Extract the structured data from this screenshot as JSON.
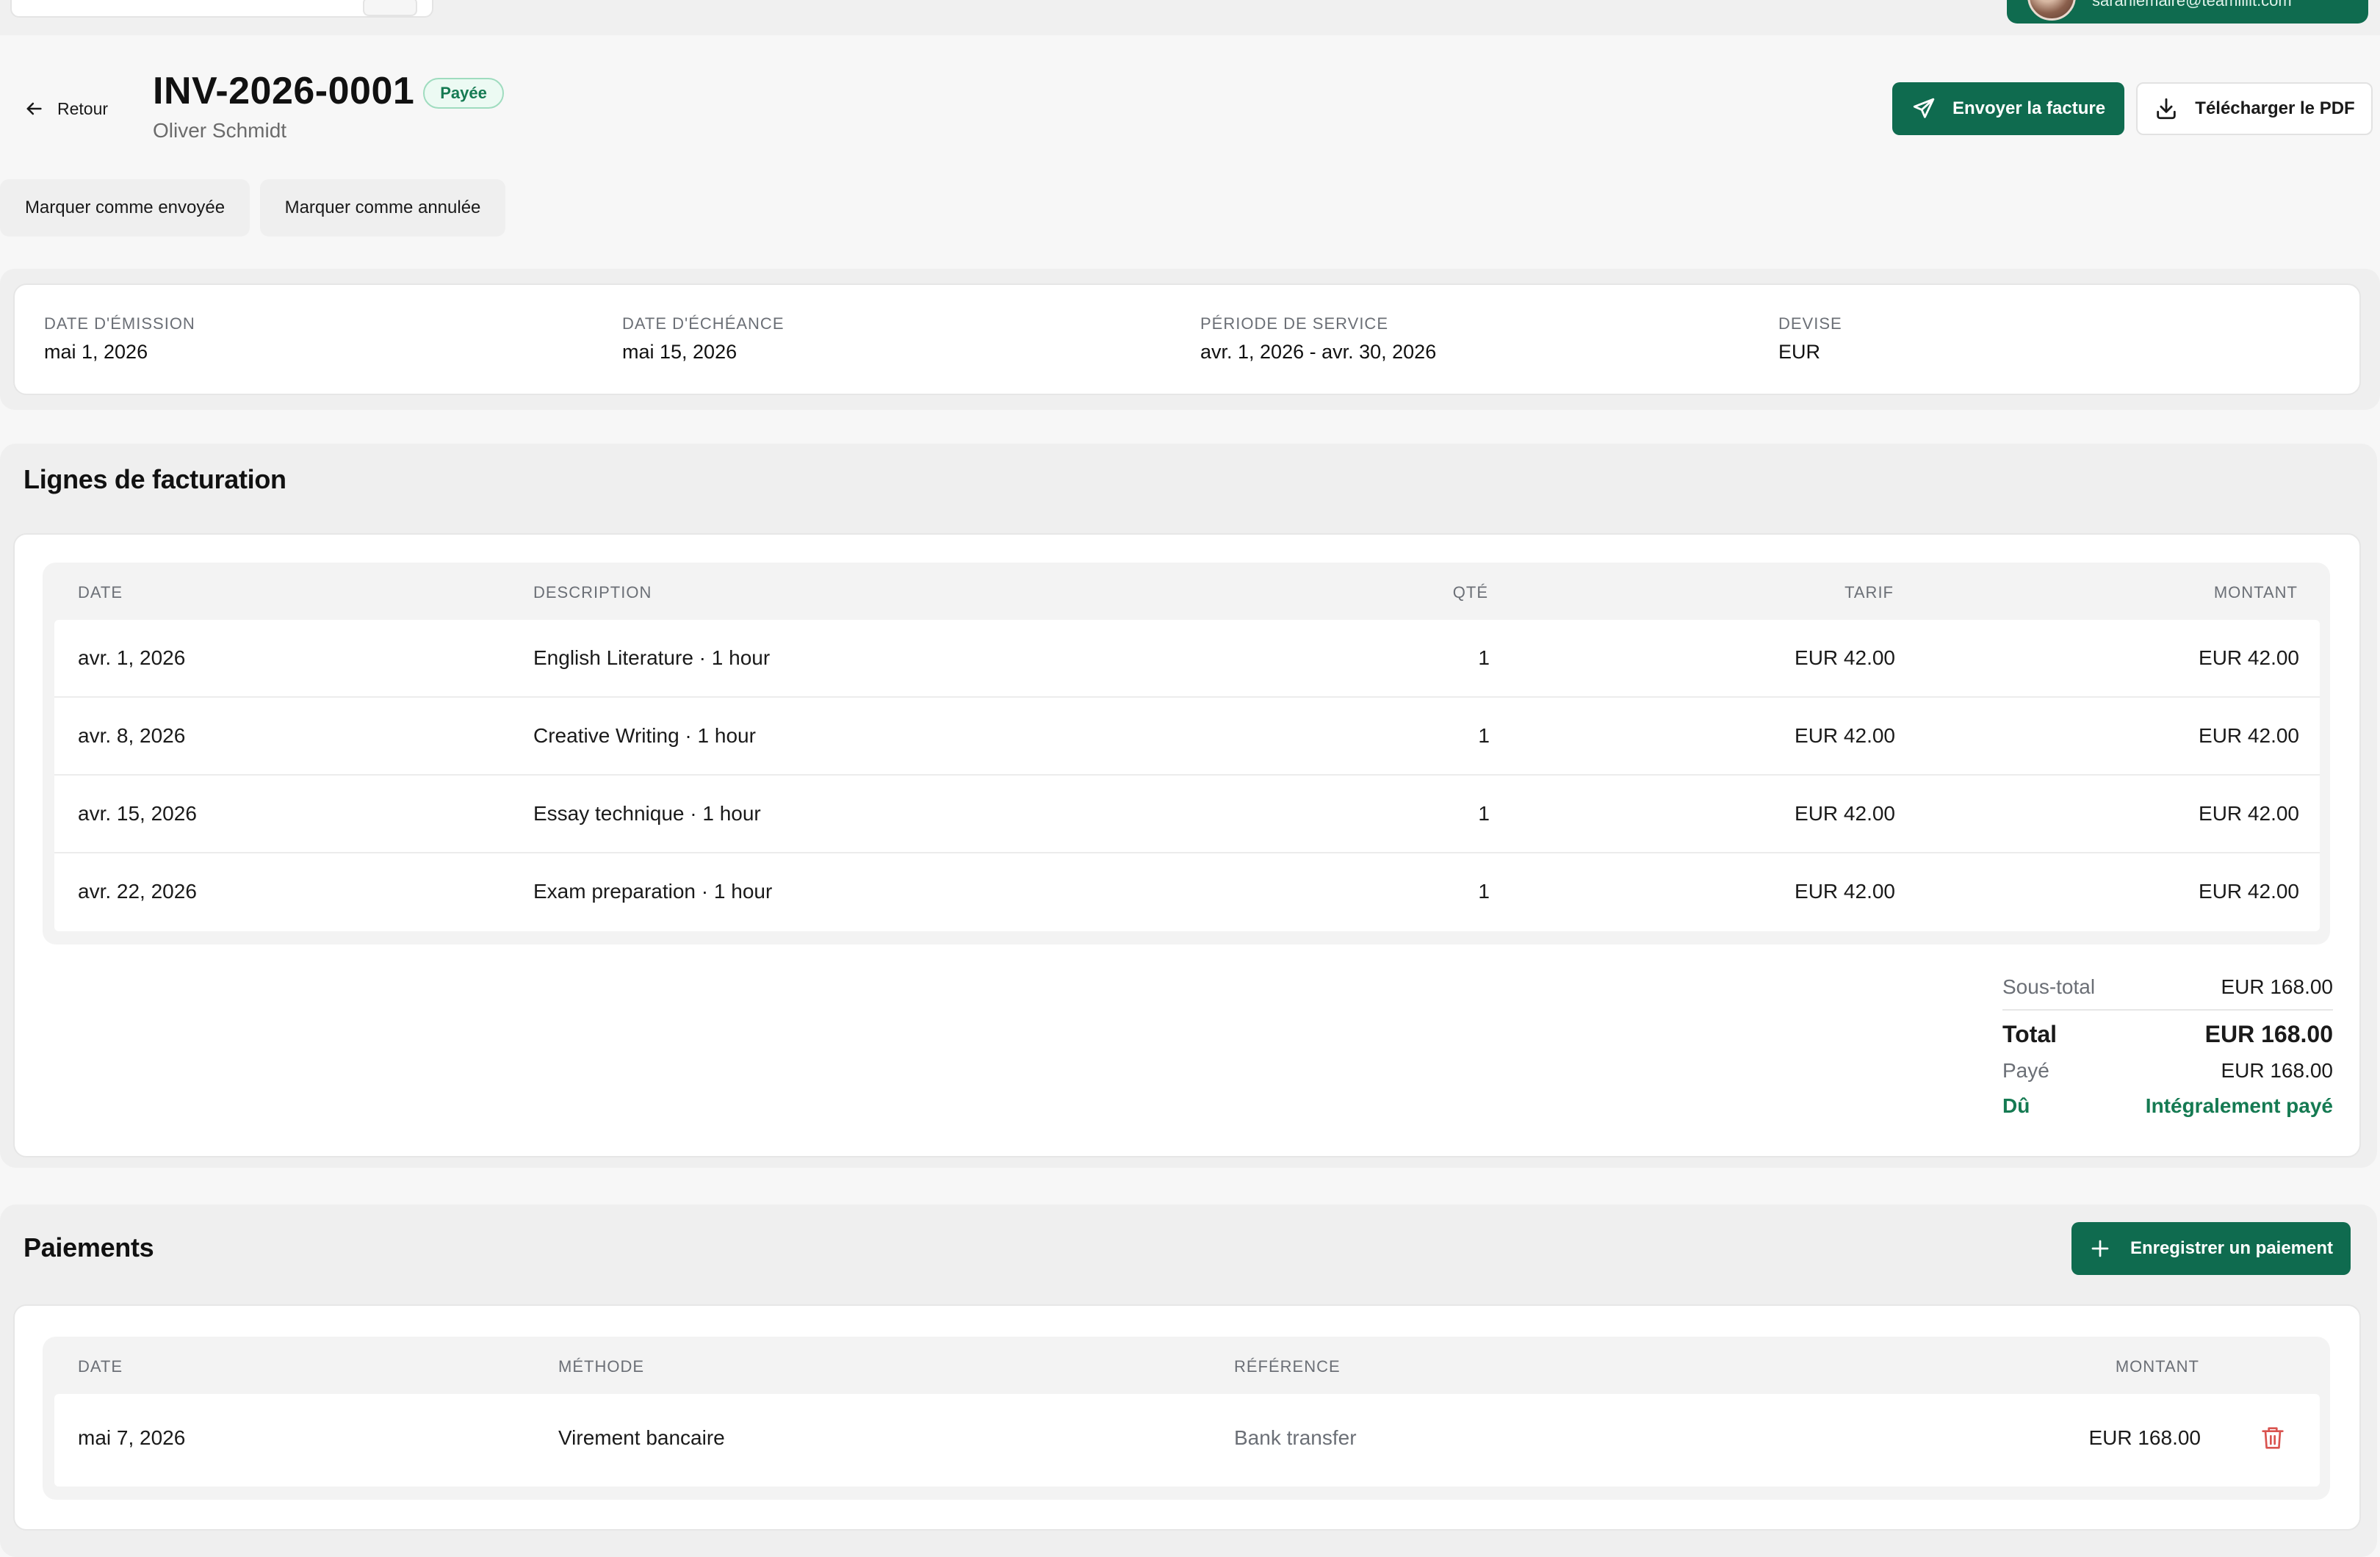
{
  "topbar": {
    "user_email": "sarahlemaire@teamillit.com"
  },
  "header": {
    "back_label": "Retour",
    "invoice_number": "INV-2026-0001",
    "status_badge": "Payée",
    "client_name": "Oliver Schmidt",
    "send_button": "Envoyer la facture",
    "download_button": "Télécharger le PDF",
    "mark_sent_button": "Marquer comme envoyée",
    "mark_cancelled_button": "Marquer comme annulée"
  },
  "info": {
    "issue_date_label": "DATE D'ÉMISSION",
    "issue_date": "mai 1, 2026",
    "due_date_label": "DATE D'ÉCHÉANCE",
    "due_date": "mai 15, 2026",
    "service_period_label": "PÉRIODE DE SERVICE",
    "service_period": "avr. 1, 2026 - avr. 30, 2026",
    "currency_label": "DEVISE",
    "currency": "EUR"
  },
  "line_items": {
    "title": "Lignes de facturation",
    "columns": {
      "date": "DATE",
      "description": "DESCRIPTION",
      "qty": "QTÉ",
      "rate": "TARIF",
      "amount": "MONTANT"
    },
    "rows": [
      {
        "date": "avr. 1, 2026",
        "description": "English Literature · 1 hour",
        "qty": "1",
        "rate": "EUR 42.00",
        "amount": "EUR 42.00"
      },
      {
        "date": "avr. 8, 2026",
        "description": "Creative Writing · 1 hour",
        "qty": "1",
        "rate": "EUR 42.00",
        "amount": "EUR 42.00"
      },
      {
        "date": "avr. 15, 2026",
        "description": "Essay technique · 1 hour",
        "qty": "1",
        "rate": "EUR 42.00",
        "amount": "EUR 42.00"
      },
      {
        "date": "avr. 22, 2026",
        "description": "Exam preparation · 1 hour",
        "qty": "1",
        "rate": "EUR 42.00",
        "amount": "EUR 42.00"
      }
    ]
  },
  "totals": {
    "subtotal_label": "Sous-total",
    "subtotal": "EUR 168.00",
    "total_label": "Total",
    "total": "EUR 168.00",
    "paid_label": "Payé",
    "paid": "EUR 168.00",
    "due_label": "Dû",
    "due": "Intégralement payé"
  },
  "payments": {
    "title": "Paiements",
    "add_button": "Enregistrer un paiement",
    "columns": {
      "date": "DATE",
      "method": "MÉTHODE",
      "reference": "RÉFÉRENCE",
      "amount": "MONTANT"
    },
    "rows": [
      {
        "date": "mai 7, 2026",
        "method": "Virement bancaire",
        "reference": "Bank transfer",
        "amount": "EUR 168.00"
      }
    ]
  },
  "colors": {
    "brand": "#0f6b4f",
    "paid_badge_text": "#157a52",
    "delete_icon": "#d9534f"
  }
}
